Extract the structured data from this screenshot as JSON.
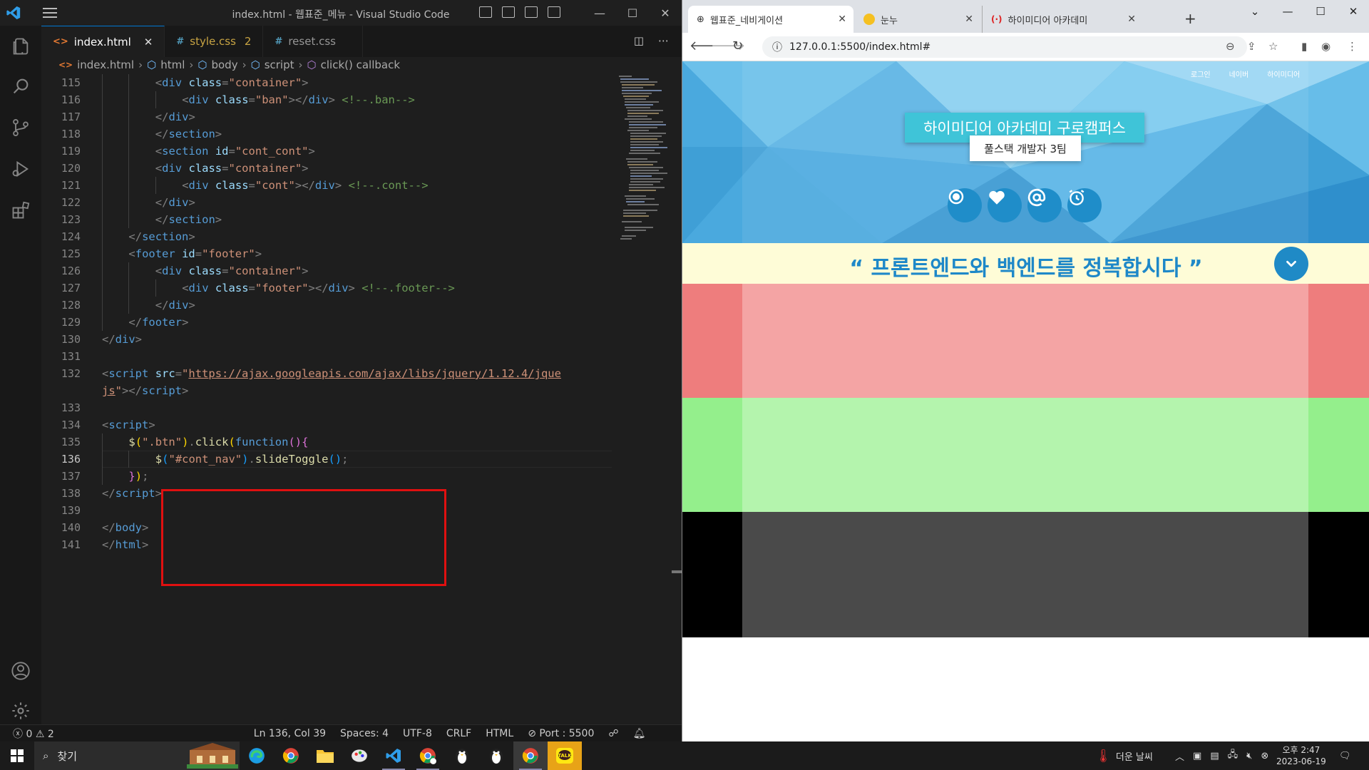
{
  "vscode": {
    "title": "index.html - 웹표준_메뉴 - Visual Studio Code",
    "tabs": [
      {
        "icon": "<>",
        "name": "index.html",
        "active": true
      },
      {
        "icon": "#",
        "name": "style.css",
        "count": "2"
      },
      {
        "icon": "#",
        "name": "reset.css"
      }
    ],
    "breadcrumb": [
      "index.html",
      "html",
      "body",
      "script",
      "click() callback"
    ],
    "line_numbers": [
      "115",
      "116",
      "117",
      "118",
      "119",
      "120",
      "121",
      "122",
      "123",
      "124",
      "125",
      "126",
      "127",
      "128",
      "129",
      "130",
      "131",
      "132",
      "",
      "133",
      "134",
      "135",
      "136",
      "137",
      "138",
      "139",
      "140",
      "141"
    ],
    "current_line": "136",
    "code_lines": [
      {
        "indent": 3,
        "parts": [
          [
            "t",
            "<"
          ],
          [
            "tg",
            "div"
          ],
          [
            "t",
            " "
          ],
          [
            "at",
            "class"
          ],
          [
            "t",
            "="
          ],
          [
            "st",
            "\"container\""
          ],
          [
            "t",
            ">"
          ]
        ]
      },
      {
        "indent": 4,
        "parts": [
          [
            "t",
            "<"
          ],
          [
            "tg",
            "div"
          ],
          [
            "t",
            " "
          ],
          [
            "at",
            "class"
          ],
          [
            "t",
            "="
          ],
          [
            "st",
            "\"ban\""
          ],
          [
            "t",
            "></"
          ],
          [
            "tg",
            "div"
          ],
          [
            "t",
            "> "
          ],
          [
            "cm",
            "<!--.ban-->"
          ]
        ]
      },
      {
        "indent": 3,
        "parts": [
          [
            "t",
            "</"
          ],
          [
            "tg",
            "div"
          ],
          [
            "t",
            ">"
          ]
        ]
      },
      {
        "indent": 3,
        "parts": [
          [
            "t",
            "</"
          ],
          [
            "tg",
            "section"
          ],
          [
            "t",
            ">"
          ]
        ]
      },
      {
        "indent": 3,
        "parts": [
          [
            "t",
            "<"
          ],
          [
            "tg",
            "section"
          ],
          [
            "t",
            " "
          ],
          [
            "at",
            "id"
          ],
          [
            "t",
            "="
          ],
          [
            "st",
            "\"cont_cont\""
          ],
          [
            "t",
            ">"
          ]
        ]
      },
      {
        "indent": 3,
        "parts": [
          [
            "t",
            "<"
          ],
          [
            "tg",
            "div"
          ],
          [
            "t",
            " "
          ],
          [
            "at",
            "class"
          ],
          [
            "t",
            "="
          ],
          [
            "st",
            "\"container\""
          ],
          [
            "t",
            ">"
          ]
        ]
      },
      {
        "indent": 4,
        "parts": [
          [
            "t",
            "<"
          ],
          [
            "tg",
            "div"
          ],
          [
            "t",
            " "
          ],
          [
            "at",
            "class"
          ],
          [
            "t",
            "="
          ],
          [
            "st",
            "\"cont\""
          ],
          [
            "t",
            "></"
          ],
          [
            "tg",
            "div"
          ],
          [
            "t",
            "> "
          ],
          [
            "cm",
            "<!--.cont-->"
          ]
        ]
      },
      {
        "indent": 3,
        "parts": [
          [
            "t",
            "</"
          ],
          [
            "tg",
            "div"
          ],
          [
            "t",
            ">"
          ]
        ]
      },
      {
        "indent": 3,
        "parts": [
          [
            "t",
            "</"
          ],
          [
            "tg",
            "section"
          ],
          [
            "t",
            ">"
          ]
        ]
      },
      {
        "indent": 2,
        "parts": [
          [
            "t",
            "</"
          ],
          [
            "tg",
            "section"
          ],
          [
            "t",
            ">"
          ]
        ]
      },
      {
        "indent": 2,
        "parts": [
          [
            "t",
            "<"
          ],
          [
            "tg",
            "footer"
          ],
          [
            "t",
            " "
          ],
          [
            "at",
            "id"
          ],
          [
            "t",
            "="
          ],
          [
            "st",
            "\"footer\""
          ],
          [
            "t",
            ">"
          ]
        ]
      },
      {
        "indent": 3,
        "parts": [
          [
            "t",
            "<"
          ],
          [
            "tg",
            "div"
          ],
          [
            "t",
            " "
          ],
          [
            "at",
            "class"
          ],
          [
            "t",
            "="
          ],
          [
            "st",
            "\"container\""
          ],
          [
            "t",
            ">"
          ]
        ]
      },
      {
        "indent": 4,
        "parts": [
          [
            "t",
            "<"
          ],
          [
            "tg",
            "div"
          ],
          [
            "t",
            " "
          ],
          [
            "at",
            "class"
          ],
          [
            "t",
            "="
          ],
          [
            "st",
            "\"footer\""
          ],
          [
            "t",
            "></"
          ],
          [
            "tg",
            "div"
          ],
          [
            "t",
            "> "
          ],
          [
            "cm",
            "<!--.footer-->"
          ]
        ]
      },
      {
        "indent": 3,
        "parts": [
          [
            "t",
            "</"
          ],
          [
            "tg",
            "div"
          ],
          [
            "t",
            ">"
          ]
        ]
      },
      {
        "indent": 2,
        "parts": [
          [
            "t",
            "</"
          ],
          [
            "tg",
            "footer"
          ],
          [
            "t",
            ">"
          ]
        ]
      },
      {
        "indent": 1,
        "parts": [
          [
            "t",
            "</"
          ],
          [
            "tg",
            "div"
          ],
          [
            "t",
            ">"
          ]
        ]
      },
      {
        "indent": 0,
        "parts": []
      },
      {
        "indent": 1,
        "parts": [
          [
            "t",
            "<"
          ],
          [
            "tg",
            "script"
          ],
          [
            "t",
            " "
          ],
          [
            "at",
            "src"
          ],
          [
            "t",
            "="
          ],
          [
            "st",
            "\""
          ],
          [
            "stu",
            "https://ajax.googleapis.com/ajax/libs/jquery/1.12.4/jque"
          ]
        ]
      },
      {
        "indent": 1,
        "parts": [
          [
            "stu",
            "js"
          ],
          [
            "st",
            "\""
          ],
          [
            "t",
            "></"
          ],
          [
            "tg",
            "script"
          ],
          [
            "t",
            ">"
          ]
        ]
      },
      {
        "indent": 0,
        "parts": []
      },
      {
        "indent": 1,
        "parts": [
          [
            "t",
            "<"
          ],
          [
            "tg",
            "script"
          ],
          [
            "t",
            ">"
          ]
        ]
      },
      {
        "indent": 2,
        "parts": [
          [
            "fn",
            "$"
          ],
          [
            "br1",
            "("
          ],
          [
            "st",
            "\".btn\""
          ],
          [
            "br1",
            ")"
          ],
          [
            "t",
            "."
          ],
          [
            "fn",
            "click"
          ],
          [
            "br1",
            "("
          ],
          [
            "kw",
            "function"
          ],
          [
            "br2",
            "()"
          ],
          [
            "br2",
            "{"
          ]
        ]
      },
      {
        "indent": 3,
        "parts": [
          [
            "fn",
            "$"
          ],
          [
            "br3",
            "("
          ],
          [
            "st",
            "\"#cont_nav\""
          ],
          [
            "br3",
            ")"
          ],
          [
            "t",
            "."
          ],
          [
            "fn",
            "slideToggle"
          ],
          [
            "br3",
            "()"
          ],
          [
            "t",
            ";"
          ]
        ]
      },
      {
        "indent": 2,
        "parts": [
          [
            "br2",
            "}"
          ],
          [
            "br1",
            ")"
          ],
          [
            "t",
            ";"
          ]
        ]
      },
      {
        "indent": 1,
        "parts": [
          [
            "t",
            "</"
          ],
          [
            "tg",
            "script"
          ],
          [
            "t",
            ">"
          ]
        ]
      },
      {
        "indent": 0,
        "parts": []
      },
      {
        "indent": 0,
        "parts": [
          [
            "t",
            "</"
          ],
          [
            "tg",
            "body"
          ],
          [
            "t",
            ">"
          ]
        ]
      },
      {
        "indent": 0,
        "parts": [
          [
            "t",
            "</"
          ],
          [
            "tg",
            "html"
          ],
          [
            "t",
            ">"
          ]
        ]
      }
    ],
    "status": {
      "errors": "0",
      "warnings": "2",
      "position": "Ln 136, Col 39",
      "spaces": "Spaces: 4",
      "encoding": "UTF-8",
      "eol": "CRLF",
      "language": "HTML",
      "port": "Port : 5500"
    }
  },
  "chrome": {
    "tabs": [
      {
        "title": "웹표준_네비게이션",
        "active": true
      },
      {
        "title": "눈누"
      },
      {
        "title": "하이미디어 아카데미"
      }
    ],
    "url": "127.0.0.1:5500/index.html#",
    "page": {
      "nav": [
        "로그인",
        "네이버",
        "하이미디어"
      ],
      "title": "하이미디어 아카데미 구로캠퍼스",
      "subtitle": "풀스택 개발자 3팀",
      "banner": "“ 프론트엔드와 백엔드를 정복합시다 ”"
    }
  },
  "taskbar": {
    "search_label": "찾기",
    "weather": "더운 날씨",
    "time": "오후 2:47",
    "date": "2023-06-19"
  },
  "colors": {
    "hero_bg": "#4aa9de",
    "banner_bg": "#fefcd7",
    "banner_text": "#1e88c8",
    "band_red_outer": "#ee7d7d",
    "band_red_inner": "#f4a4a4",
    "band_green_outer": "#94ef8c",
    "band_green_inner": "#b4f4ad",
    "band_black_outer": "#000000",
    "band_black_inner": "#4a4a4a"
  }
}
